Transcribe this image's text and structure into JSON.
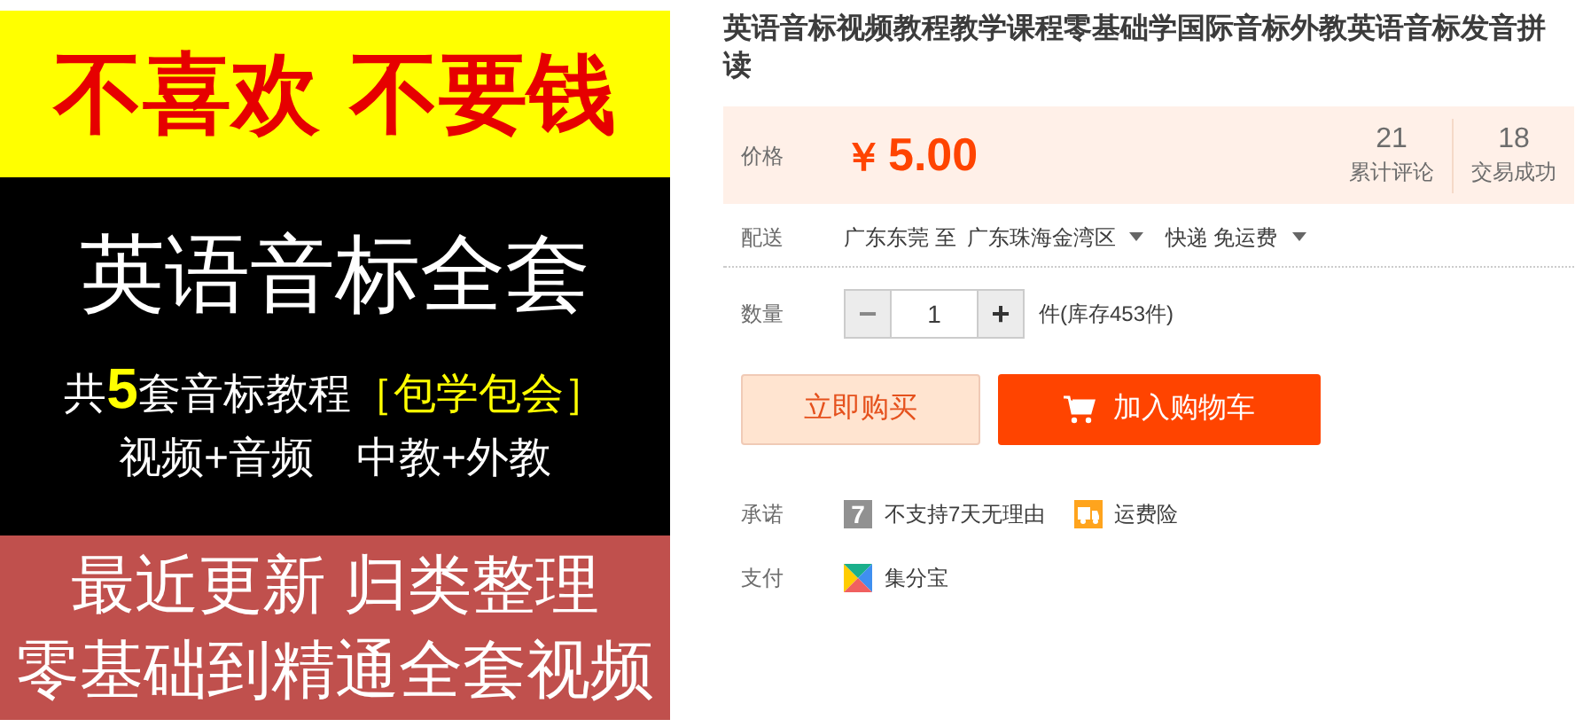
{
  "banner": {
    "top": "不喜欢 不要钱",
    "middle_title": "英语音标全套",
    "middle_line": "共**5**套音标教程",
    "middle_tag": "［包学包会］",
    "middle_sub": "视频+音频　中教+外教",
    "bottom_lines": [
      "最近更新 归类整理",
      "零基础到精通全套视频"
    ]
  },
  "title": "英语音标视频教程教学课程零基础学国际音标外教英语音标发音拼读",
  "price": {
    "label": "价格",
    "currency": "￥",
    "amount": "5.00"
  },
  "stats": [
    {
      "value": "21",
      "label": "累计评论"
    },
    {
      "value": "18",
      "label": "交易成功"
    }
  ],
  "delivery": {
    "label": "配送",
    "from": "广东东莞 至",
    "to": "广东珠海金湾区",
    "shipping": "快递 免运费"
  },
  "quantity": {
    "label": "数量",
    "minus": "−",
    "value": "1",
    "plus": "+",
    "stock": "件(库存453件)",
    "minus_disabled": true
  },
  "buttons": {
    "buy": "立即购买",
    "cart": "加入购物车"
  },
  "promise": {
    "label": "承诺",
    "items": [
      {
        "kind": "seven",
        "icon_text": "7",
        "text": "不支持7天无理由"
      },
      {
        "kind": "truck",
        "text": "运费险"
      }
    ]
  },
  "pay": {
    "label": "支付",
    "method": "集分宝"
  }
}
